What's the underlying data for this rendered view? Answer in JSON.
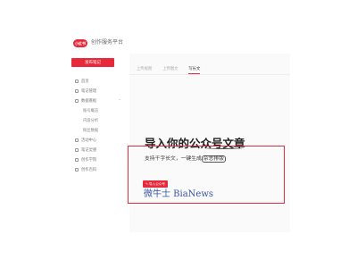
{
  "header": {
    "brand_badge": "小红书",
    "brand_name": "创作服务平台"
  },
  "sidebar": {
    "new_note_label": "发布笔记",
    "items": [
      {
        "label": "首页"
      },
      {
        "label": "笔记管理"
      },
      {
        "label": "数据看板"
      },
      {
        "label": "账号概览"
      },
      {
        "label": "内容分析"
      },
      {
        "label": "粉丝数据"
      },
      {
        "label": "活动中心"
      },
      {
        "label": "笔记灵感"
      },
      {
        "label": "创作学院"
      },
      {
        "label": "创作百科"
      }
    ]
  },
  "main": {
    "tabs": [
      {
        "label": "上传视频"
      },
      {
        "label": "上传图文"
      },
      {
        "label": "写长文"
      }
    ],
    "headline": "导入你的公众号文章",
    "subtext_prefix": "支持千字长文，一键生成",
    "subtext_tag": "杂志排版",
    "import_button": "导入公众号"
  },
  "watermark": "微牛士 BiaNews"
}
